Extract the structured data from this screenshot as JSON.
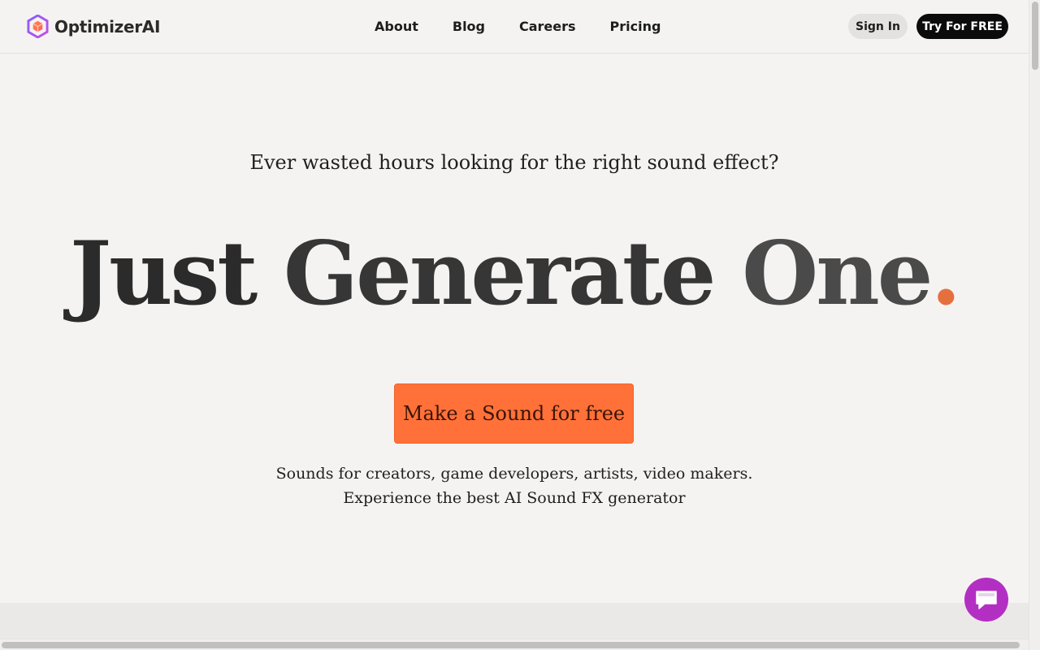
{
  "header": {
    "brand": "OptimizerAI",
    "nav": [
      {
        "label": "About"
      },
      {
        "label": "Blog"
      },
      {
        "label": "Careers"
      },
      {
        "label": "Pricing"
      }
    ],
    "sign_in": "Sign In",
    "try_free": "Try For FREE"
  },
  "hero": {
    "eyebrow": "Ever wasted hours looking for the right sound effect?",
    "headline_words": [
      "Just",
      "Generate",
      "One"
    ],
    "headline_dot": ".",
    "cta": "Make a Sound for free",
    "sub_line1": "Sounds for creators, game developers, artists, video makers.",
    "sub_line2": "Experience the best AI Sound FX generator"
  },
  "icons": {
    "logo": "cube-logo-icon",
    "chat": "chat-bubble-icon"
  },
  "colors": {
    "accent": "#ff7138",
    "dot": "#e5703e",
    "chat": "#b32fc4",
    "background": "#f5f3f1"
  }
}
